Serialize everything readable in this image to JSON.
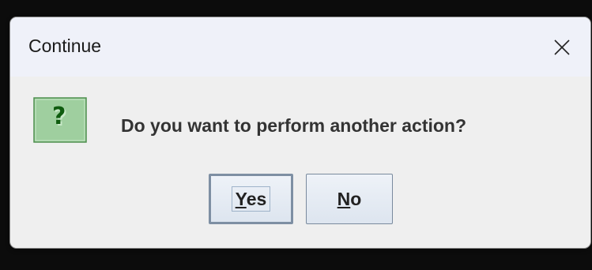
{
  "dialog": {
    "title": "Continue",
    "message": "Do you want to perform another action?",
    "icon": "question-icon",
    "buttons": {
      "yes": {
        "mnemonic": "Y",
        "rest": "es"
      },
      "no": {
        "mnemonic": "N",
        "rest": "o"
      }
    },
    "default_button": "Yes"
  },
  "colors": {
    "icon_fill": "#9fcf9f",
    "icon_mark": "#0f5c0f",
    "button_border": "#7a8a9e",
    "title_bar": "#eff1f9",
    "body": "#efefef"
  }
}
